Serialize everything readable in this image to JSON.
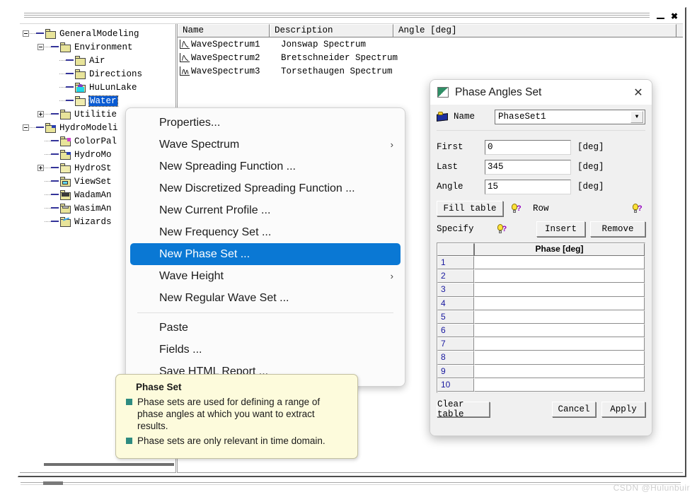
{
  "window": {
    "restore_label": "restore-button",
    "close_label": "✖"
  },
  "tree": {
    "items": [
      {
        "label": "GeneralModeling",
        "depth": 0,
        "toggle": "minus",
        "icon": "folder",
        "selected": false
      },
      {
        "label": "Environment",
        "depth": 1,
        "toggle": "minus",
        "icon": "folder",
        "selected": false
      },
      {
        "label": "Air",
        "depth": 2,
        "toggle": "none",
        "icon": "folder",
        "selected": false
      },
      {
        "label": "Directions",
        "depth": 2,
        "toggle": "none",
        "icon": "folder",
        "selected": false
      },
      {
        "label": "HuLunLake",
        "depth": 2,
        "toggle": "none",
        "icon": "folder-water",
        "selected": false
      },
      {
        "label": "Water",
        "depth": 2,
        "toggle": "none",
        "icon": "folder-open",
        "selected": true
      },
      {
        "label": "Utilitie",
        "depth": 1,
        "toggle": "plus",
        "icon": "folder",
        "selected": false
      },
      {
        "label": "HydroModeli",
        "depth": 0,
        "toggle": "minus",
        "icon": "folder-blue",
        "selected": false
      },
      {
        "label": "ColorPal",
        "depth": 1,
        "toggle": "none",
        "icon": "folder-magenta",
        "selected": false
      },
      {
        "label": "HydroMo",
        "depth": 1,
        "toggle": "none",
        "icon": "folder-blue",
        "selected": false
      },
      {
        "label": "HydroSt",
        "depth": 1,
        "toggle": "plus",
        "icon": "folder-open",
        "selected": false
      },
      {
        "label": "ViewSet",
        "depth": 1,
        "toggle": "none",
        "icon": "folder-cyan",
        "selected": false
      },
      {
        "label": "WadamAn",
        "depth": 1,
        "toggle": "none",
        "icon": "folder-dark",
        "selected": false
      },
      {
        "label": "WasimAn",
        "depth": 1,
        "toggle": "none",
        "icon": "folder-gray",
        "selected": false
      },
      {
        "label": "Wizards",
        "depth": 1,
        "toggle": "none",
        "icon": "folder-pen",
        "selected": false
      }
    ]
  },
  "listview": {
    "columns": [
      "Name",
      "Description",
      "Angle [deg]"
    ],
    "rows": [
      {
        "icon": "spectrum-jonswap-icon",
        "name": "WaveSpectrum1",
        "description": "Jonswap Spectrum",
        "angle": ""
      },
      {
        "icon": "spectrum-bretschneider-icon",
        "name": "WaveSpectrum2",
        "description": "Bretschneider Spectrum",
        "angle": ""
      },
      {
        "icon": "spectrum-torsethaugen-icon",
        "name": "WaveSpectrum3",
        "description": "Torsethaugen Spectrum",
        "angle": ""
      }
    ]
  },
  "context_menu": {
    "items": [
      {
        "label": "Properties...",
        "submenu": false,
        "selected": false,
        "separator_after": false
      },
      {
        "label": "Wave Spectrum",
        "submenu": true,
        "selected": false,
        "separator_after": false
      },
      {
        "label": "New Spreading Function ...",
        "submenu": false,
        "selected": false,
        "separator_after": false
      },
      {
        "label": "New Discretized Spreading Function ...",
        "submenu": false,
        "selected": false,
        "separator_after": false
      },
      {
        "label": "New Current Profile ...",
        "submenu": false,
        "selected": false,
        "separator_after": false
      },
      {
        "label": "New Frequency Set ...",
        "submenu": false,
        "selected": false,
        "separator_after": false
      },
      {
        "label": "New Phase Set ...",
        "submenu": false,
        "selected": true,
        "separator_after": false
      },
      {
        "label": "Wave Height",
        "submenu": true,
        "selected": false,
        "separator_after": false
      },
      {
        "label": "New Regular Wave Set ...",
        "submenu": false,
        "selected": false,
        "separator_after": true
      },
      {
        "label": "Paste",
        "submenu": false,
        "selected": false,
        "separator_after": false
      },
      {
        "label": "Fields ...",
        "submenu": false,
        "selected": false,
        "separator_after": false
      },
      {
        "label": "Save HTML Report ...",
        "submenu": false,
        "selected": false,
        "separator_after": false
      }
    ],
    "submenu_glyph": "›",
    "highlight_color": "#0a78d4"
  },
  "tooltip": {
    "title": "Phase Set",
    "bullets": [
      "Phase sets are used for defining a range of phase angles at which you want to extract results.",
      "Phase sets are only relevant in time domain."
    ],
    "background_color": "#fdfbdc",
    "bullet_color": "#2e8b80"
  },
  "dialog": {
    "title": "Phase Angles Set",
    "close_glyph": "✕",
    "name_label": "Name",
    "name_value": "PhaseSet1",
    "combo_arrow": "▼",
    "fields": [
      {
        "label": "First",
        "value": "0",
        "unit": "[deg]"
      },
      {
        "label": "Last",
        "value": "345",
        "unit": "[deg]"
      },
      {
        "label": "Angle",
        "value": "15",
        "unit": "[deg]"
      }
    ],
    "fill_table_label": "Fill table",
    "row_label": "Row",
    "specify_label": "Specify",
    "insert_label": "Insert",
    "remove_label": "Remove",
    "help_glyph": "?",
    "table": {
      "column_header": "Phase [deg]",
      "rows": [
        {
          "index": "1",
          "value": ""
        },
        {
          "index": "2",
          "value": ""
        },
        {
          "index": "3",
          "value": ""
        },
        {
          "index": "4",
          "value": ""
        },
        {
          "index": "5",
          "value": ""
        },
        {
          "index": "6",
          "value": ""
        },
        {
          "index": "7",
          "value": ""
        },
        {
          "index": "8",
          "value": ""
        },
        {
          "index": "9",
          "value": ""
        },
        {
          "index": "10",
          "value": ""
        }
      ]
    },
    "clear_table_label": "Clear table",
    "cancel_label": "Cancel",
    "apply_label": "Apply"
  },
  "watermark": "CSDN @Hulunbuir"
}
